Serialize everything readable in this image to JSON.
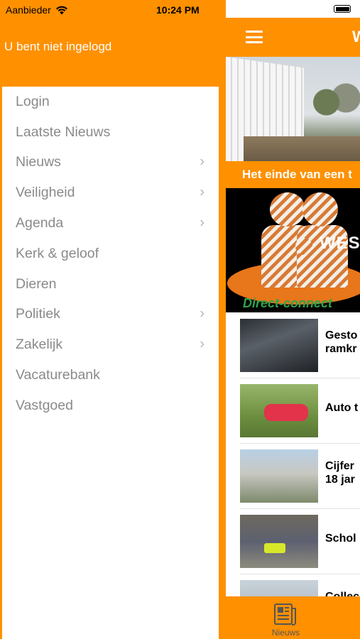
{
  "status_bar": {
    "carrier": "Aanbieder",
    "time": "10:24 PM"
  },
  "drawer": {
    "login_state": "U bent niet ingelogd",
    "items": [
      {
        "label": "Login",
        "has_submenu": false
      },
      {
        "label": "Laatste Nieuws",
        "has_submenu": false
      },
      {
        "label": "Nieuws",
        "has_submenu": true
      },
      {
        "label": "Veiligheid",
        "has_submenu": true
      },
      {
        "label": "Agenda",
        "has_submenu": true
      },
      {
        "label": "Kerk & geloof",
        "has_submenu": false
      },
      {
        "label": "Dieren",
        "has_submenu": false
      },
      {
        "label": "Politiek",
        "has_submenu": true
      },
      {
        "label": "Zakelijk",
        "has_submenu": true
      },
      {
        "label": "Vacaturebank",
        "has_submenu": false
      },
      {
        "label": "Vastgoed",
        "has_submenu": false
      }
    ],
    "chevron": "›"
  },
  "main": {
    "appbar_title": "W",
    "headline": "Het einde van een t",
    "banner": {
      "logo_text": "WES",
      "caption": "Direct-connect"
    },
    "news": [
      {
        "title_lines": [
          "Gesto",
          "ramkr"
        ]
      },
      {
        "title_lines": [
          "Auto t"
        ]
      },
      {
        "title_lines": [
          "Cijfer",
          "18 jar"
        ]
      },
      {
        "title_lines": [
          "Schol"
        ]
      },
      {
        "title_lines": [
          "Collec"
        ]
      }
    ]
  },
  "tabbar": {
    "tabs": [
      {
        "label": "Nieuws",
        "icon": "newspaper-icon"
      }
    ]
  },
  "colors": {
    "brand": "#ff9000",
    "menu_text": "#8a8a8a",
    "green_caption": "#2ea54b"
  }
}
